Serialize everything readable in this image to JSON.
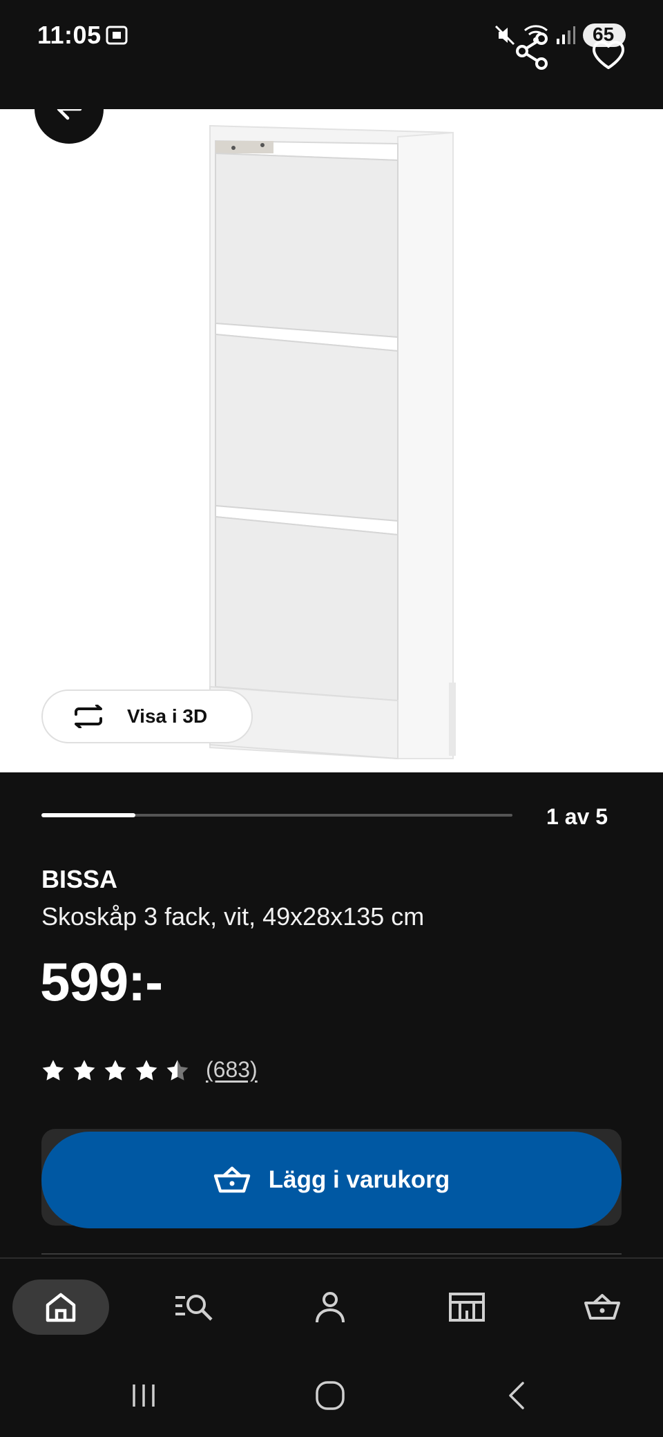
{
  "status_bar": {
    "time": "11:05",
    "battery": "65",
    "icons": [
      "screenshot-icon",
      "mute-icon",
      "wifi-icon",
      "signal-icon",
      "battery-icon"
    ]
  },
  "header": {
    "back_icon": "arrow-left-icon",
    "share_icon": "share-icon",
    "favorite_icon": "heart-icon"
  },
  "gallery": {
    "view_3d_label": "Visa i 3D",
    "view_3d_icon": "rotate-3d-icon",
    "counter": "1 av 5",
    "progress": 0.2
  },
  "product": {
    "brand": "BISSA",
    "description": "Skoskåp 3 fack, vit, 49x28x135 cm",
    "price": "599:-",
    "rating": 4.5,
    "review_count": "(683)"
  },
  "actions": {
    "add_to_cart_label": "Lägg i varukorg",
    "add_to_cart_icon": "basket-icon"
  },
  "bottom_nav": {
    "items": [
      "home-icon",
      "search-list-icon",
      "profile-icon",
      "store-icon",
      "cart-icon"
    ],
    "active": "home-icon"
  },
  "system_nav": {
    "items": [
      "recents-icon",
      "home-circle-icon",
      "back-chevron-icon"
    ]
  },
  "colors": {
    "background": "#111111",
    "accent": "#0058a3",
    "hero_background": "#ffffff",
    "muted_text": "#cfcfcf"
  }
}
